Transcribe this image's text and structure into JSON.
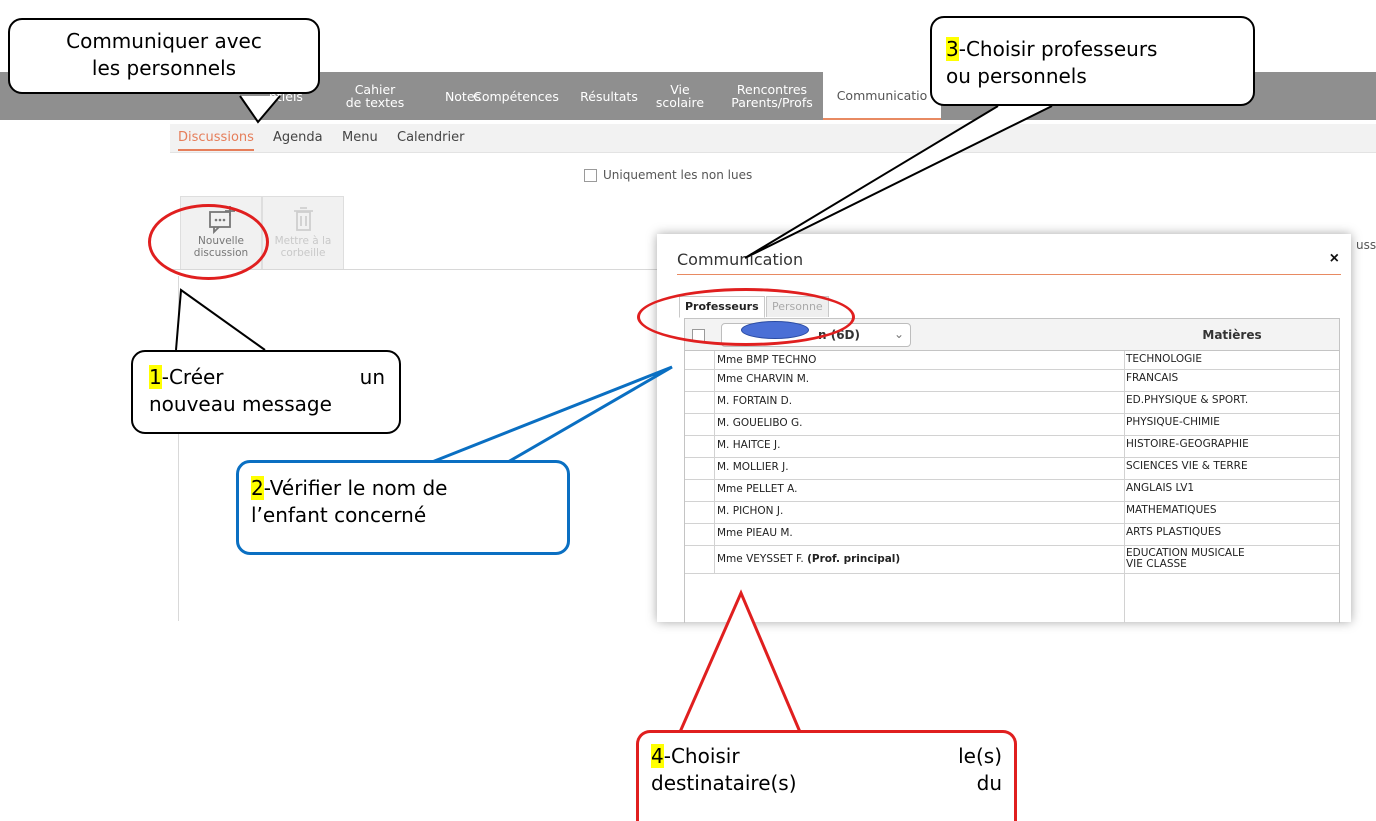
{
  "app": {
    "nav_items": [
      {
        "label": "...ntiels"
      },
      {
        "label_line1": "Cahier",
        "label_line2": "de textes"
      },
      {
        "label": "Notes"
      },
      {
        "label": "Compétences"
      },
      {
        "label": "Résultats"
      },
      {
        "label_line1": "Vie",
        "label_line2": "scolaire"
      },
      {
        "label_line1": "Rencontres",
        "label_line2": "Parents/Profs"
      },
      {
        "label": "Communicatio",
        "active": true
      }
    ],
    "sub_nav": [
      {
        "label": "Discussions",
        "active": true
      },
      {
        "label": "Agenda"
      },
      {
        "label": "Menu"
      },
      {
        "label": "Calendrier"
      }
    ],
    "filter_label": "Uniquement les non lues",
    "toolbar": {
      "new_label_1": "Nouvelle",
      "new_label_2": "discussion",
      "trash_label_1": "Mettre à la",
      "trash_label_2": "corbeille"
    },
    "cut_right_text": "ussi"
  },
  "dialog": {
    "title": "Communication",
    "close": "×",
    "tabs": [
      {
        "label": "Professeurs",
        "active": true
      },
      {
        "label": "Personnels",
        "visible_text": "Personne"
      }
    ],
    "class_select": "n (6D)",
    "col_subjects": "Matières",
    "rows": [
      {
        "name": "Mme BMP TECHNO",
        "subject": "TECHNOLOGIE"
      },
      {
        "name": "Mme CHARVIN M.",
        "subject": "FRANCAIS"
      },
      {
        "name": "M. FORTAIN D.",
        "subject": "ED.PHYSIQUE & SPORT."
      },
      {
        "name": "M. GOUELIBO G.",
        "subject": "PHYSIQUE-CHIMIE"
      },
      {
        "name": "M. HAITCE J.",
        "subject": "HISTOIRE-GEOGRAPHIE"
      },
      {
        "name": "M. MOLLIER J.",
        "subject": "SCIENCES VIE & TERRE"
      },
      {
        "name": "Mme PELLET A.",
        "subject": "ANGLAIS LV1"
      },
      {
        "name": "M. PICHON J.",
        "subject": "MATHEMATIQUES"
      },
      {
        "name": "Mme PIEAU M.",
        "subject": "ARTS PLASTIQUES"
      },
      {
        "name": "Mme VEYSSET F.",
        "name_bold": "(Prof. principal)",
        "subject": "EDUCATION MUSICALE",
        "subject2": "VIE CLASSE"
      }
    ]
  },
  "annotations": {
    "top_left": {
      "line1": "Communiquer avec",
      "line2": "les personnels"
    },
    "step1": {
      "num": "1",
      "text1": "-Créer",
      "text1b": "un",
      "line2": "nouveau message"
    },
    "step2": {
      "num": "2",
      "text1": "-Vérifier le nom de",
      "line2": "l’enfant concerné"
    },
    "step3": {
      "num": "3",
      "text1": "-Choisir professeurs",
      "line2": "ou personnels"
    },
    "step4": {
      "num": "4",
      "text1": "-Choisir",
      "text1b": "le(s)",
      "line2a": "destinataire(s)",
      "line2b": "du"
    },
    "colors": {
      "red": "#e01f1f",
      "blue": "#0a6fc2",
      "highlight": "#ffff00"
    }
  }
}
